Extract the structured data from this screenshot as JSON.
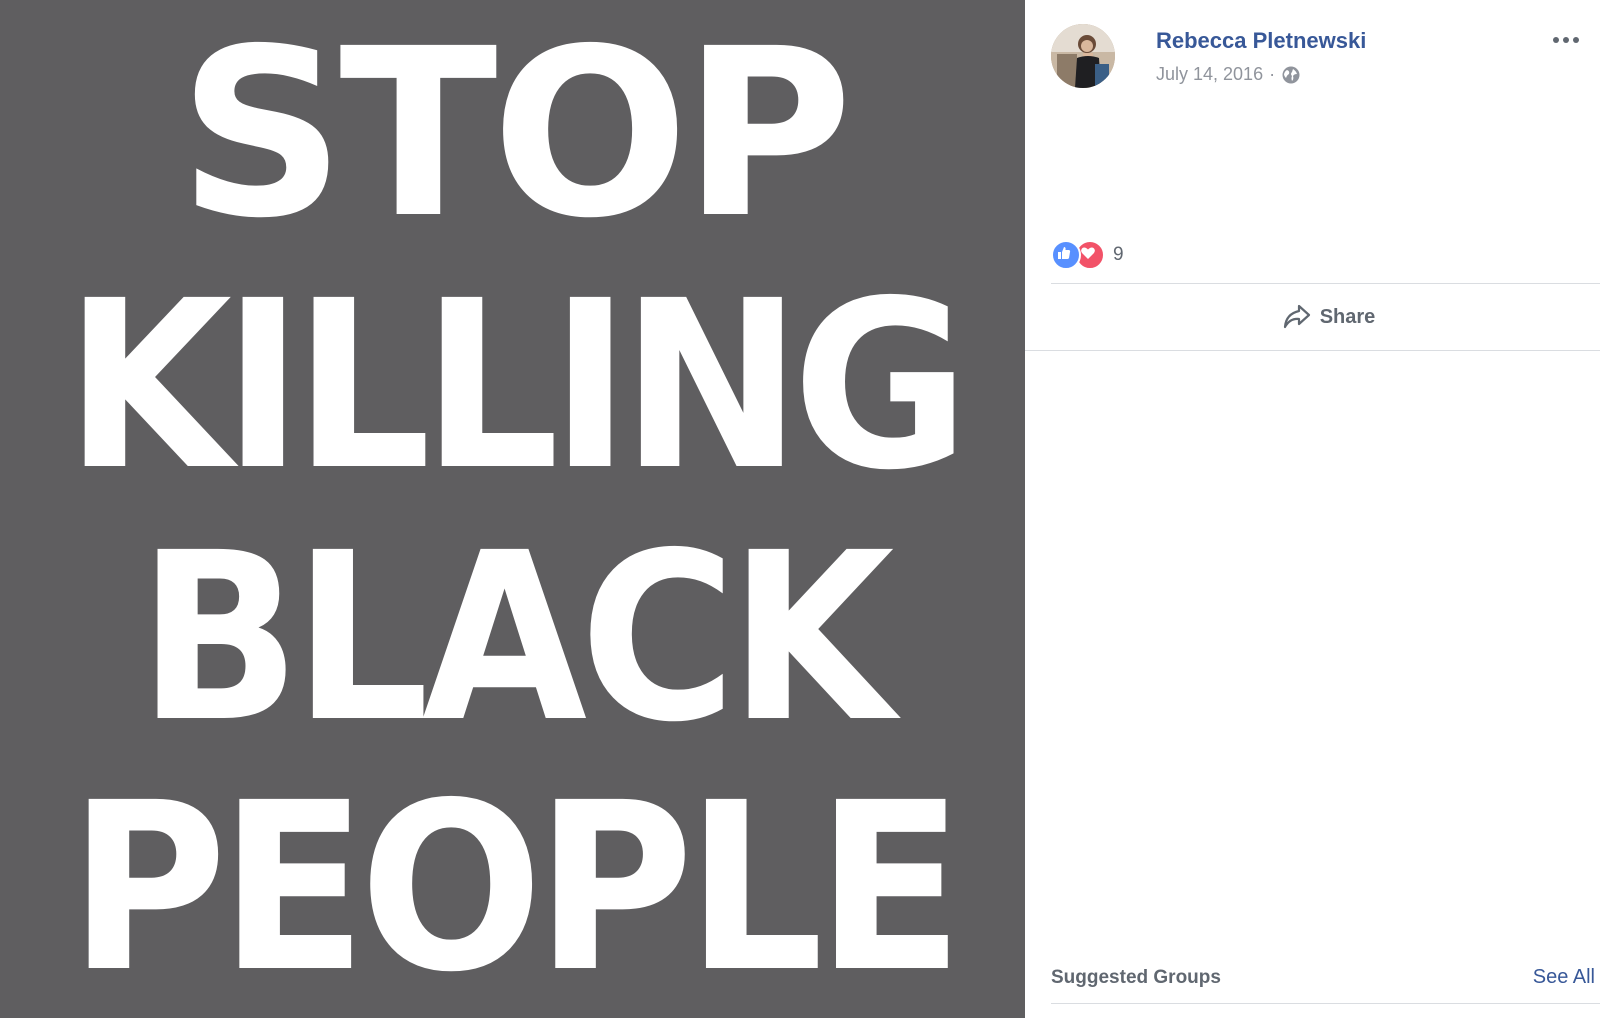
{
  "photo": {
    "lines": [
      "STOP",
      "KILLING",
      "BLACK",
      "PEOPLE"
    ],
    "background_color": "#5f5e60",
    "text_color": "#ffffff"
  },
  "post": {
    "author": "Rebecca Pletnewski",
    "date": "July 14, 2016",
    "separator": "·",
    "privacy_icon": "globe-icon",
    "more_icon": "more-options-icon"
  },
  "reactions": {
    "icons": [
      "like-icon",
      "love-icon"
    ],
    "count": "9"
  },
  "actions": {
    "share_label": "Share"
  },
  "suggested_groups": {
    "title": "Suggested Groups",
    "see_all": "See All"
  },
  "colors": {
    "link_blue": "#385898",
    "muted_text": "#606770",
    "like_blue": "#5890ff",
    "love_red": "#f25268"
  }
}
